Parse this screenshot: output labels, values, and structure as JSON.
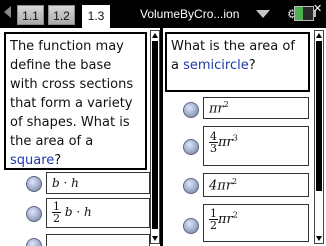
{
  "tabs": [
    {
      "label": "1.1"
    },
    {
      "label": "1.2"
    },
    {
      "label": "1.3"
    }
  ],
  "active_tab": "1.3",
  "document_title": "VolumeByCro...ion",
  "left_question": {
    "text_before": "The function may define the base with cross sections that form a variety of shapes. What is the area of a ",
    "highlight": "square",
    "text_after": "?"
  },
  "left_choices": [
    {
      "left": "b",
      "op": "·",
      "right": "h"
    },
    {
      "num": "1",
      "den": "2",
      "left": "b",
      "op": "·",
      "right": "h"
    }
  ],
  "right_question": {
    "text_before": "What is the area of a ",
    "highlight": "semicircle",
    "text_after": "?"
  },
  "right_choices": [
    {
      "expr": "πr",
      "exp": "2"
    },
    {
      "num": "4",
      "den": "3",
      "expr": "πr",
      "exp": "3"
    },
    {
      "expr": "4πr",
      "exp": "2"
    },
    {
      "num": "1",
      "den": "2",
      "expr": "πr",
      "exp": "2"
    }
  ],
  "colors": {
    "highlight": "#1e3aa8",
    "topbar": "#000000"
  },
  "icons": [
    "nav-left-arrow-icon",
    "document-caret-icon",
    "battery-icon",
    "gear-icon",
    "close-icon",
    "radio-button-icon"
  ]
}
